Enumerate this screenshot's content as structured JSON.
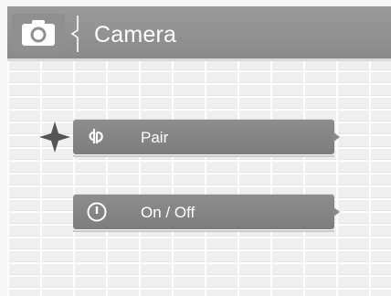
{
  "header": {
    "title": "Camera",
    "icon": "camera-icon"
  },
  "menu": {
    "items": [
      {
        "label": "Pair",
        "icon": "pair-icon",
        "selected": true
      },
      {
        "label": "On / Off",
        "icon": "power-icon",
        "selected": false
      }
    ]
  },
  "colors": {
    "header": "#8f8f8f",
    "button": "#828282",
    "background": "#efefef",
    "text": "#ffffff"
  }
}
